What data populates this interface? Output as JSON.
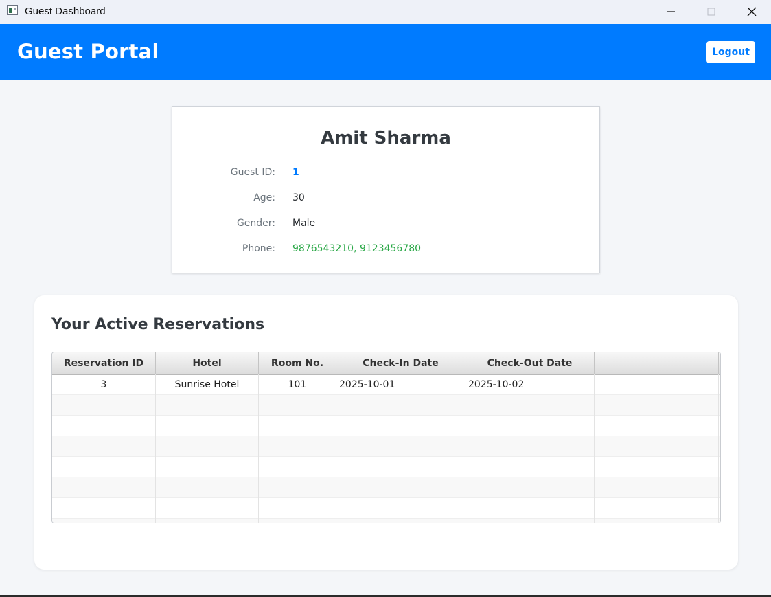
{
  "window": {
    "title": "Guest Dashboard"
  },
  "header": {
    "title": "Guest Portal",
    "logout_label": "Logout",
    "color": "#007bff"
  },
  "profile": {
    "name": "Amit Sharma",
    "fields": [
      {
        "label": "Guest ID:",
        "value": "1"
      },
      {
        "label": "Age:",
        "value": "30"
      },
      {
        "label": "Gender:",
        "value": "Male"
      },
      {
        "label": "Phone:",
        "value": "9876543210, 9123456780"
      }
    ]
  },
  "reservations": {
    "title": "Your Active Reservations",
    "columns": [
      "Reservation ID",
      "Hotel",
      "Room No.",
      "Check-In Date",
      "Check-Out Date",
      ""
    ],
    "rows": [
      [
        "3",
        "Sunrise Hotel",
        "101",
        "2025-10-01",
        "2025-10-02",
        ""
      ]
    ]
  },
  "icons": {
    "app": "app-window-icon",
    "minimize": "minimize-icon",
    "maximize": "maximize-icon",
    "close": "close-icon"
  }
}
